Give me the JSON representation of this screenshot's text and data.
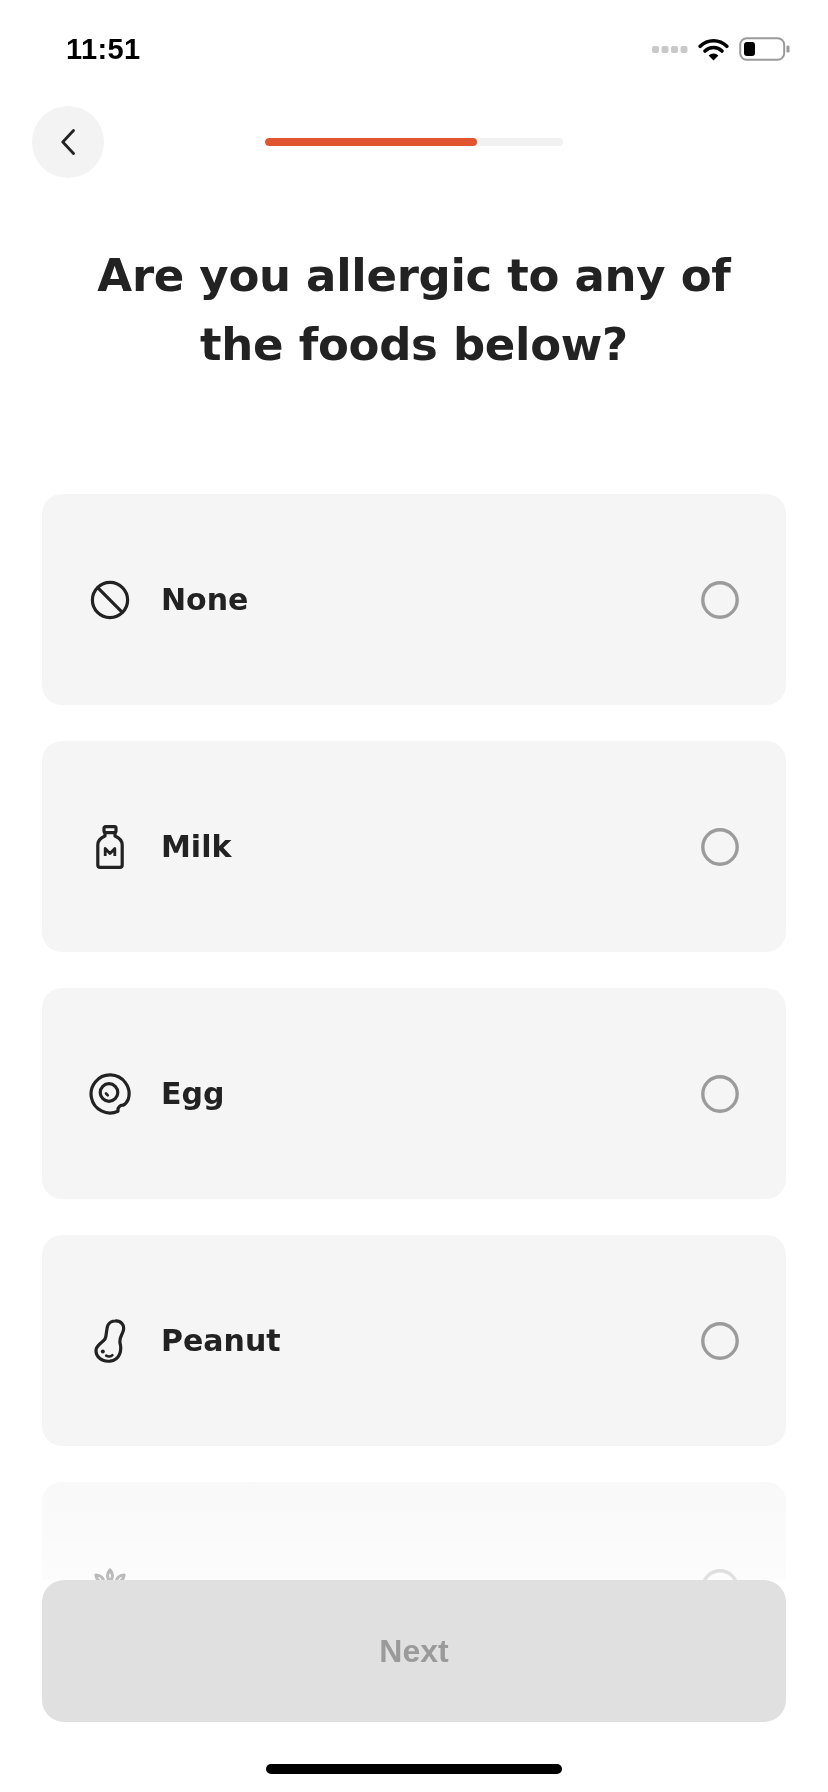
{
  "status_bar": {
    "time": "11:51"
  },
  "header": {
    "progress": {
      "level": 0.71
    }
  },
  "question": "Are you allergic to any of the foods below?",
  "options": [
    {
      "label": "None",
      "selected": false
    },
    {
      "label": "Milk",
      "selected": false
    },
    {
      "label": "Egg",
      "selected": false
    },
    {
      "label": "Peanut",
      "selected": false
    },
    {
      "selected": false
    }
  ],
  "next_button": {
    "label": "Next",
    "disabled": true
  }
}
